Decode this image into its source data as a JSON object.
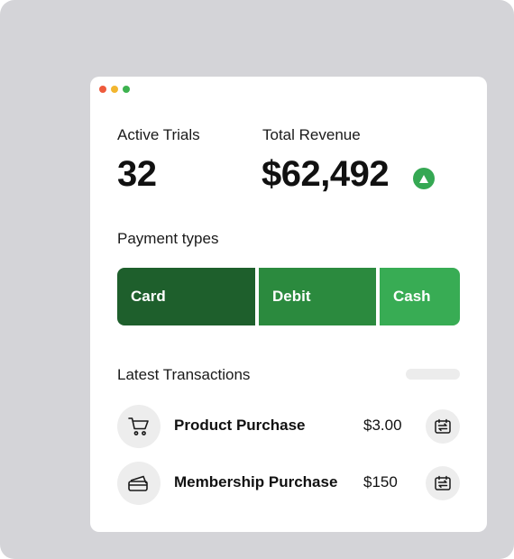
{
  "window": {
    "controls": [
      {
        "name": "close",
        "color": "#ee5a3c"
      },
      {
        "name": "minimize",
        "color": "#f2b630"
      },
      {
        "name": "maximize",
        "color": "#3db24f"
      }
    ]
  },
  "stats": {
    "active_trials": {
      "label": "Active Trials",
      "value": "32"
    },
    "total_revenue": {
      "label": "Total Revenue",
      "value": "$62,492",
      "trend_icon": "arrow-up-icon",
      "trend_color": "#35a853"
    }
  },
  "payment_types": {
    "title": "Payment types",
    "segments": [
      {
        "label": "Card",
        "share": 0.41,
        "color": "#1e5f2c"
      },
      {
        "label": "Debit",
        "share": 0.35,
        "color": "#2b8a3e"
      },
      {
        "label": "Cash",
        "share": 0.24,
        "color": "#38ac54"
      }
    ]
  },
  "transactions": {
    "title": "Latest Transactions",
    "items": [
      {
        "name": "Product Purchase",
        "amount": "$3.00",
        "icon": "shopping-cart-icon",
        "action_icon": "transfer-icon"
      },
      {
        "name": "Membership Purchase",
        "amount": "$150",
        "icon": "credit-cards-icon",
        "action_icon": "transfer-icon"
      }
    ]
  }
}
